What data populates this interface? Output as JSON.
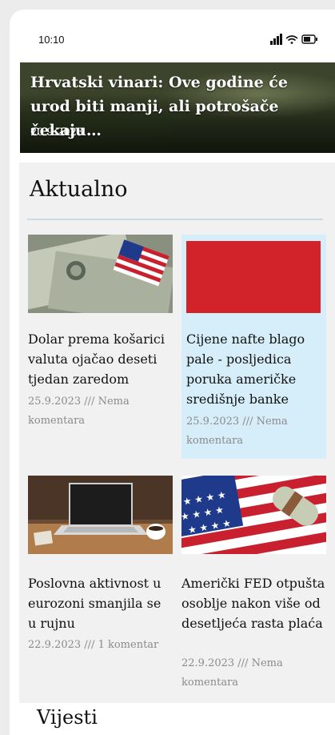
{
  "status_bar": {
    "time": "10:10",
    "icons": [
      "signal-icon",
      "wifi-icon",
      "battery-icon"
    ]
  },
  "hero": {
    "title": "Hrvatski vinari: Ove godine će urod biti manji, ali potrošače čekaju…",
    "date": "20.9.2023"
  },
  "section": {
    "title": "Aktualno",
    "colors": {
      "highlight": "#d6eef9",
      "background": "#f1f1f1",
      "divider": "#c9dbe6"
    }
  },
  "articles": [
    {
      "title": "Dolar prema košarici valuta ojačao deseti tjedan zaredom",
      "meta": "25.9.2023 /// Nema komentara",
      "image": "dollar-bills-flag-image"
    },
    {
      "title": "Cijene nafte blago pale - posljedica poruka američke središnje banke",
      "meta": "25.9.2023 /// Nema komentara",
      "image": "red-placeholder-image",
      "image_color": "#d2232a"
    },
    {
      "title": "Poslovna aktivnost u eurozoni smanjila se u rujnu",
      "meta": "22.9.2023 /// 1 komentar",
      "image": "laptop-coffee-image"
    },
    {
      "title": "Američki FED otpušta osoblje nakon više od desetljeća rasta plaća",
      "meta": "22.9.2023 /// Nema komentara",
      "image": "us-flag-money-roll-image"
    }
  ],
  "next_section": {
    "title": "Vijesti"
  }
}
